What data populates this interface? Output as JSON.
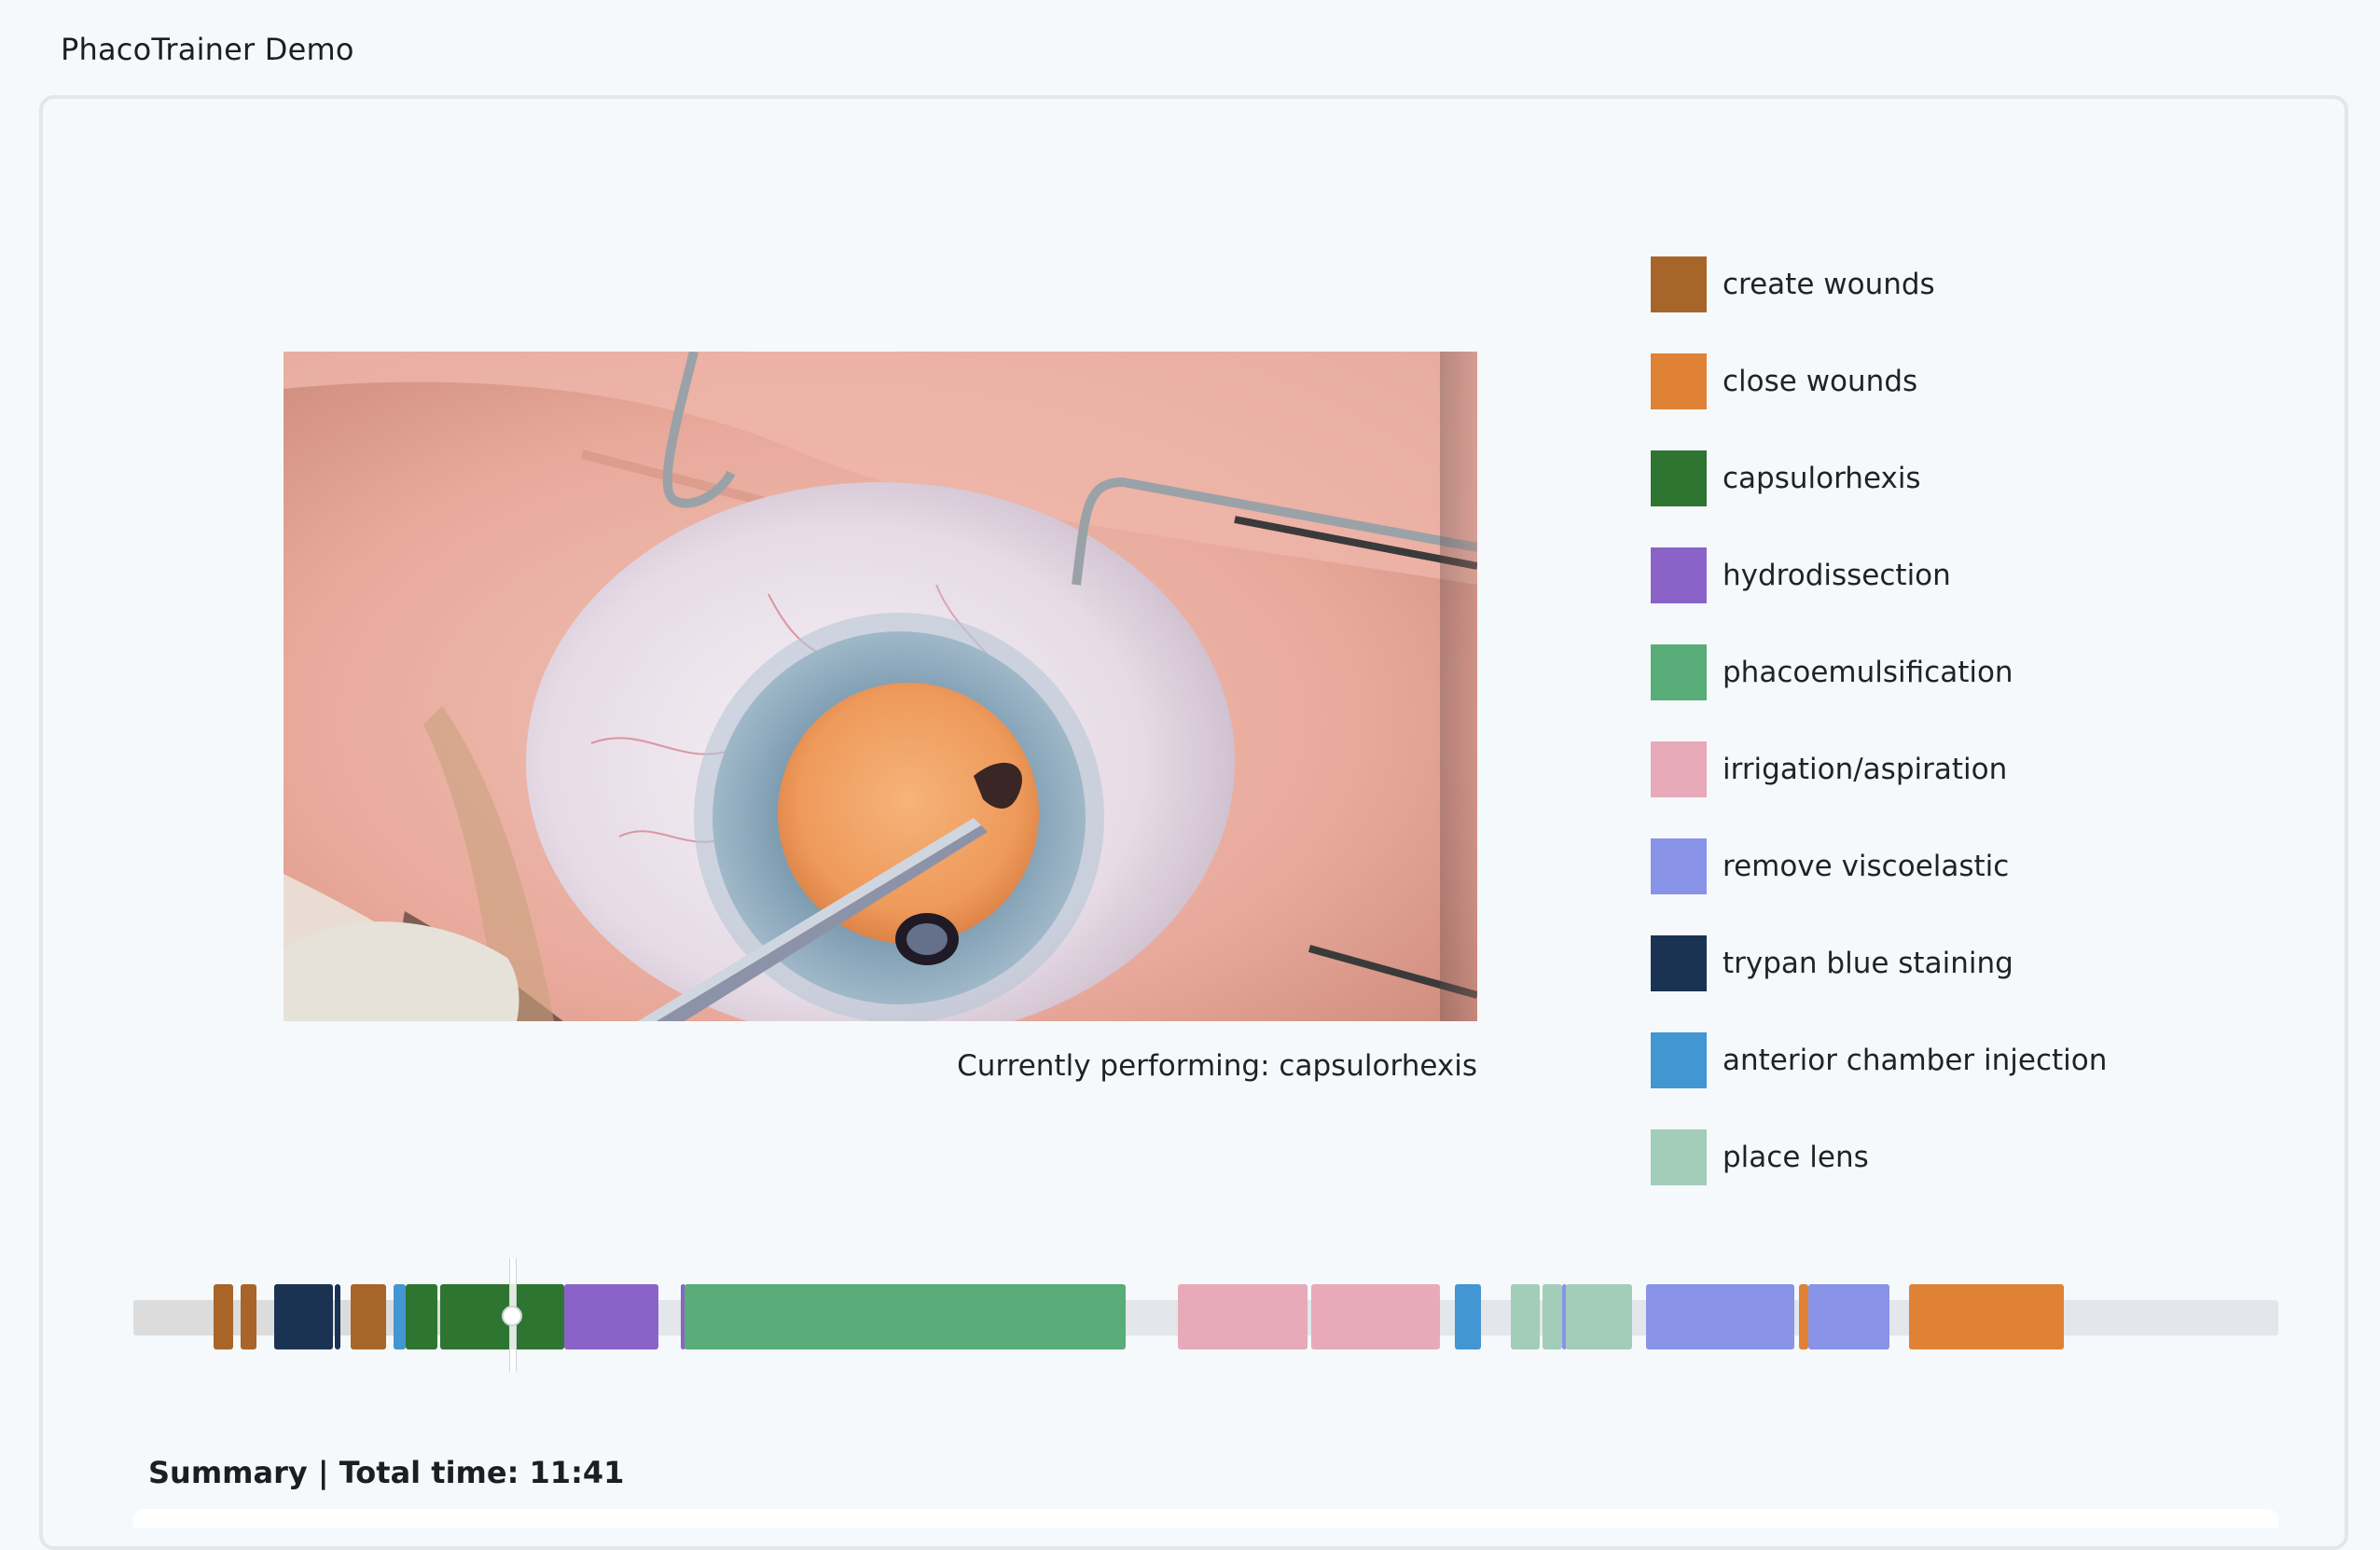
{
  "app": {
    "title": "PhacoTrainer Demo"
  },
  "video": {
    "caption": "Currently performing: capsulorhexis",
    "current_phase": "capsulorhexis"
  },
  "legend": [
    {
      "label": "create wounds",
      "color": "#a8652a"
    },
    {
      "label": "close wounds",
      "color": "#e08235"
    },
    {
      "label": "capsulorhexis",
      "color": "#2e7532"
    },
    {
      "label": "hydrodissection",
      "color": "#8b63c8"
    },
    {
      "label": "phacoemulsification",
      "color": "#58ad78"
    },
    {
      "label": "irrigation/aspiration",
      "color": "#e8a9b8"
    },
    {
      "label": "remove viscoelastic",
      "color": "#8993e8"
    },
    {
      "label": "trypan blue staining",
      "color": "#1a3352"
    },
    {
      "label": "anterior chamber injection",
      "color": "#4296d2"
    },
    {
      "label": "place lens",
      "color": "#a2cdb9"
    }
  ],
  "timeline": {
    "playhead_fraction": 0.175,
    "segments": [
      {
        "phase": "create wounds",
        "start": 0.0373,
        "end": 0.0465,
        "color": "#a8652a"
      },
      {
        "phase": "create wounds",
        "start": 0.05,
        "end": 0.0575,
        "color": "#a8652a"
      },
      {
        "phase": "trypan blue staining",
        "start": 0.0655,
        "end": 0.093,
        "color": "#1a3352"
      },
      {
        "phase": "trypan blue staining",
        "start": 0.094,
        "end": 0.0967,
        "color": "#1a3352"
      },
      {
        "phase": "create wounds",
        "start": 0.1015,
        "end": 0.118,
        "color": "#a8652a"
      },
      {
        "phase": "anterior chamber injection",
        "start": 0.1215,
        "end": 0.127,
        "color": "#4296d2"
      },
      {
        "phase": "capsulorhexis",
        "start": 0.127,
        "end": 0.142,
        "color": "#2e7532"
      },
      {
        "phase": "capsulorhexis",
        "start": 0.143,
        "end": 0.201,
        "color": "#2e7532"
      },
      {
        "phase": "hydrodissection",
        "start": 0.201,
        "end": 0.245,
        "color": "#8b63c8"
      },
      {
        "phase": "hydrodissection",
        "start": 0.255,
        "end": 0.257,
        "color": "#8b63c8"
      },
      {
        "phase": "phacoemulsification",
        "start": 0.257,
        "end": 0.4625,
        "color": "#58ad78"
      },
      {
        "phase": "irrigation/aspiration",
        "start": 0.487,
        "end": 0.5475,
        "color": "#e8a9b8"
      },
      {
        "phase": "irrigation/aspiration",
        "start": 0.549,
        "end": 0.609,
        "color": "#e8a9b8"
      },
      {
        "phase": "anterior chamber injection",
        "start": 0.616,
        "end": 0.628,
        "color": "#4296d2"
      },
      {
        "phase": "place lens",
        "start": 0.642,
        "end": 0.6555,
        "color": "#a2cdb9"
      },
      {
        "phase": "place lens",
        "start": 0.657,
        "end": 0.666,
        "color": "#a2cdb9"
      },
      {
        "phase": "remove viscoelastic",
        "start": 0.666,
        "end": 0.668,
        "color": "#8993e8"
      },
      {
        "phase": "place lens",
        "start": 0.668,
        "end": 0.699,
        "color": "#a2cdb9"
      },
      {
        "phase": "remove viscoelastic",
        "start": 0.705,
        "end": 0.774,
        "color": "#8993e8"
      },
      {
        "phase": "close wounds",
        "start": 0.7765,
        "end": 0.781,
        "color": "#e08235"
      },
      {
        "phase": "remove viscoelastic",
        "start": 0.781,
        "end": 0.819,
        "color": "#8993e8"
      },
      {
        "phase": "close wounds",
        "start": 0.828,
        "end": 0.9,
        "color": "#e08235"
      }
    ]
  },
  "summary": {
    "title": "Summary | Total time: 11:41"
  }
}
